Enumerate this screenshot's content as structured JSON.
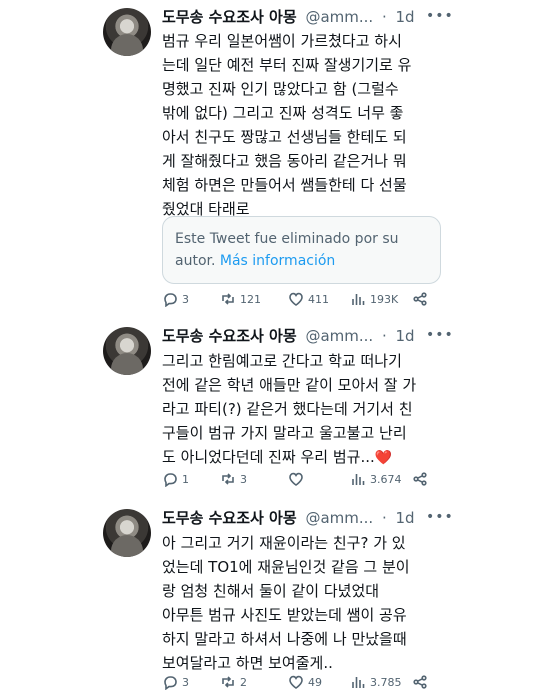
{
  "tweets": [
    {
      "name": "도무송 수요조사 아몽",
      "handle": "@amm...",
      "dot": "·",
      "time": "1d",
      "text": "범규 우리 일본어쌤이 가르쳤다고 하시\n는데 일단 예전 부터 진짜 잘생기기로 유\n명했고 진짜 인기 많았다고 함 (그럴수\n밖에 없다) 그리고 진짜 성격도 너무 좋\n아서 친구도 짱많고 선생님들 한테도 되\n게 잘해줬다고 했음 동아리 같은거나 뭐\n체험 하면은 만들어서 쌤들한테 다 선물\n줬었대 타래로",
      "quote": {
        "text": "Este Tweet fue eliminado por su autor.",
        "link": "Más información"
      },
      "stats": {
        "replies": "3",
        "retweets": "121",
        "likes": "411",
        "views": "193K"
      }
    },
    {
      "name": "도무송 수요조사 아몽",
      "handle": "@amm...",
      "dot": "·",
      "time": "1d",
      "text": "그리고 한림예고로 간다고 학교 떠나기\n전에 같은 학년 애들만 같이 모아서 잘 가\n라고 파티(?) 같은거 했다는데 거기서 친\n구들이 범규 가지 말라고 울고불고 난리\n도 아니었다던데 진짜 우리 범규...",
      "heart": "❤️",
      "stats": {
        "replies": "1",
        "retweets": "3",
        "likes": "",
        "views": "3.674"
      }
    },
    {
      "name": "도무송 수요조사 아몽",
      "handle": "@amm...",
      "dot": "·",
      "time": "1d",
      "text": "아 그리고 거기 재윤이라는 친구? 가 있\n었는데 TO1에 재윤님인것 같음 그 분이\n랑 엄청 친해서 둘이 같이 다녔었대\n아무튼 범규 사진도 받았는데 쌤이 공유\n하지 말라고 하셔서 나중에 나 만났을때\n보여달라고 하면 보여줄게..",
      "stats": {
        "replies": "3",
        "retweets": "2",
        "likes": "49",
        "views": "3.785"
      }
    }
  ]
}
